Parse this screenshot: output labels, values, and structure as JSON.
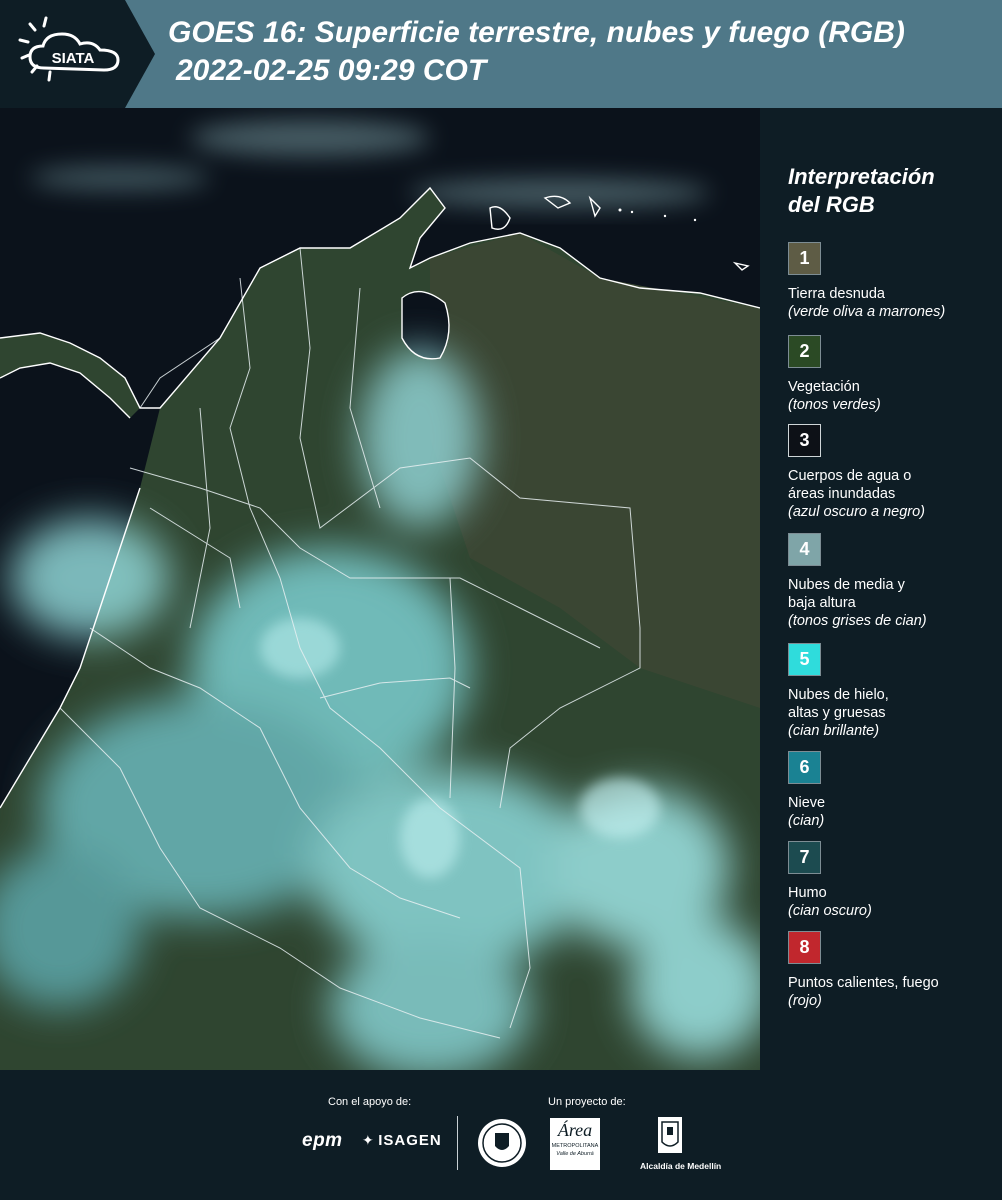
{
  "header": {
    "logo_text": "SIATA",
    "title_line1": "GOES 16: Superficie terrestre, nubes y fuego (RGB)",
    "title_line2": "2022-02-25 09:29 COT"
  },
  "legend": {
    "title_line1": "Interpretación",
    "title_line2": "del RGB",
    "items": [
      {
        "num": "1",
        "label": "Tierra desnuda",
        "label2": "",
        "desc": "(verde oliva a marrones)",
        "color": "#5e5c45"
      },
      {
        "num": "2",
        "label": "Vegetación",
        "label2": "",
        "desc": "(tonos verdes)",
        "color": "#2b4a25"
      },
      {
        "num": "3",
        "label": "Cuerpos de agua o",
        "label2": "áreas inundadas",
        "desc": "(azul oscuro a negro)",
        "color": "#0d1117"
      },
      {
        "num": "4",
        "label": "Nubes de media y",
        "label2": "baja altura",
        "desc": "(tonos grises de cian)",
        "color": "#7fa5a8"
      },
      {
        "num": "5",
        "label": "Nubes de hielo,",
        "label2": "altas y gruesas",
        "desc": "(cian brillante)",
        "color": "#2fdcdc"
      },
      {
        "num": "6",
        "label": "Nieve",
        "label2": "",
        "desc": "(cian)",
        "color": "#1a8293"
      },
      {
        "num": "7",
        "label": "Humo",
        "label2": "",
        "desc": "(cian oscuro)",
        "color": "#1c4b50"
      },
      {
        "num": "8",
        "label": "Puntos calientes, fuego",
        "label2": "",
        "desc": "(rojo)",
        "color": "#c1272d"
      }
    ]
  },
  "footer": {
    "support_label": "Con el apoyo de:",
    "project_label": "Un proyecto de:",
    "epm": "epm",
    "isagen": "ISAGEN",
    "area_metro_line1": "METROPOLITANA",
    "area_metro_line2": "Valle de Aburrá",
    "alcaldia": "Alcaldía de Medellín"
  }
}
